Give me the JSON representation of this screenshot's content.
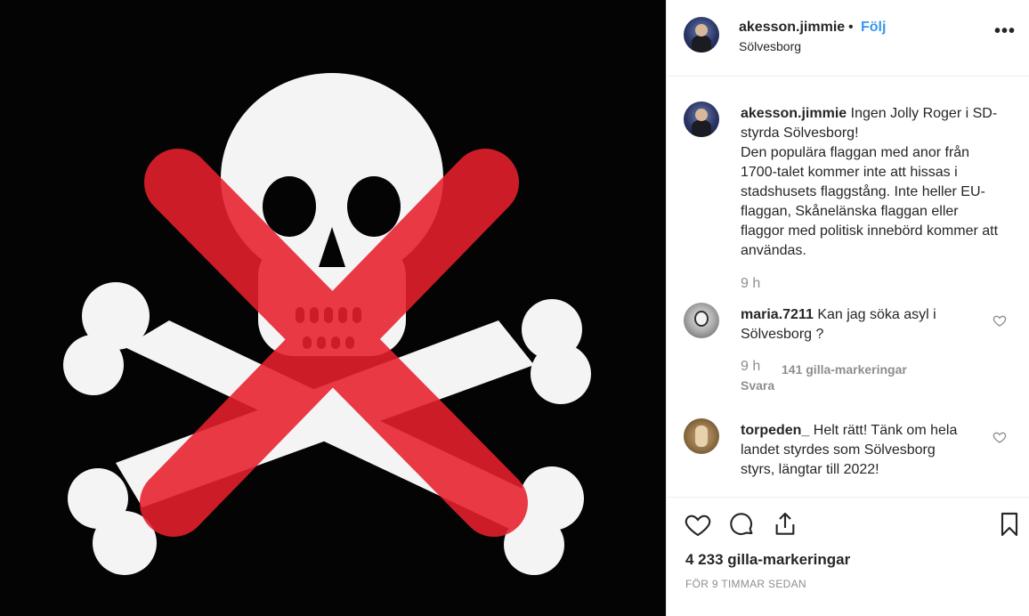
{
  "header": {
    "username": "akesson.jimmie",
    "separator": "•",
    "follow_label": "Följ",
    "location": "Sölvesborg",
    "more_label": "•••"
  },
  "caption": {
    "username": "akesson.jimmie",
    "text": "Ingen Jolly Roger i SD-styrda Sölvesborg!",
    "body": "Den populära flaggan med anor från 1700-talet kommer inte att hissas i stadshusets flaggstång. Inte heller EU-flaggan, Skånelänska flaggan eller flaggor med politisk innebörd kommer att användas.",
    "time": "9 h"
  },
  "comments": [
    {
      "username": "maria.7211",
      "text": "Kan jag söka asyl i Sölvesborg ?",
      "time": "9 h",
      "likes": "141 gilla-markeringar",
      "reply": "Svara"
    },
    {
      "username": "torpeden_",
      "text": "Helt rätt! Tänk om hela landet styrdes som Sölvesborg styrs, längtar till 2022!"
    }
  ],
  "footer": {
    "likes": "4 233 gilla-markeringar",
    "posted": "FÖR 9 TIMMAR SEDAN"
  },
  "icons": {
    "like": "heart-icon",
    "comment": "comment-icon",
    "share": "share-icon",
    "save": "bookmark-icon"
  },
  "colors": {
    "link": "#3897f0",
    "cross": "#e8202e",
    "muted": "#8e8e8e"
  }
}
